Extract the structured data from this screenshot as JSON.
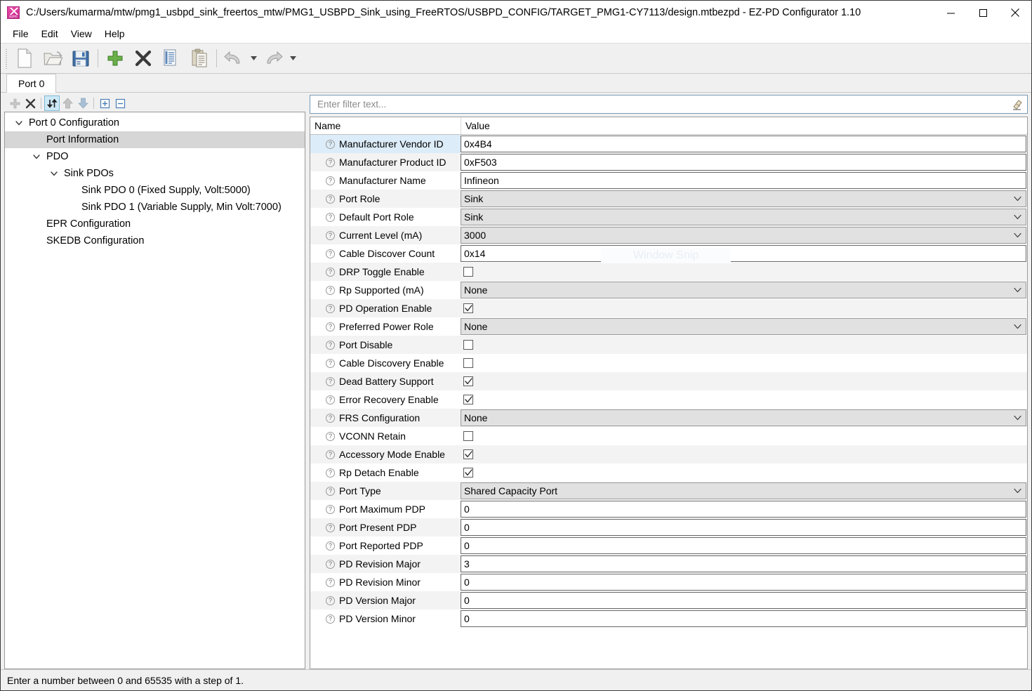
{
  "window": {
    "title": "C:/Users/kumarma/mtw/pmg1_usbpd_sink_freertos_mtw/PMG1_USBPD_Sink_using_FreeRTOS/USBPD_CONFIG/TARGET_PMG1-CY7113/design.mtbezpd - EZ-PD Configurator 1.10",
    "app_icon": "ezpd-logo-icon",
    "minimize": "—",
    "maximize": "□",
    "close": "✕"
  },
  "menubar": {
    "items": [
      {
        "label": "File"
      },
      {
        "label": "Edit"
      },
      {
        "label": "View"
      },
      {
        "label": "Help"
      }
    ]
  },
  "toolbar": {
    "buttons": [
      {
        "name": "new-file-icon",
        "tip": "New"
      },
      {
        "name": "open-folder-icon",
        "tip": "Open"
      },
      {
        "name": "save-icon",
        "tip": "Save"
      },
      {
        "name": "add-plus-icon",
        "tip": "Add"
      },
      {
        "name": "delete-x-icon",
        "tip": "Delete"
      },
      {
        "name": "copy-icon",
        "tip": "Copy"
      },
      {
        "name": "paste-icon",
        "tip": "Paste"
      },
      {
        "name": "undo-icon",
        "tip": "Undo"
      },
      {
        "name": "redo-icon",
        "tip": "Redo"
      }
    ]
  },
  "tabs": [
    {
      "label": "Port 0",
      "active": true
    }
  ],
  "tree_toolbar": {
    "buttons": [
      {
        "name": "add-icon",
        "active": false
      },
      {
        "name": "delete-icon",
        "active": false
      },
      {
        "name": "sort-toggle-icon",
        "active": true
      },
      {
        "name": "move-up-icon",
        "active": false
      },
      {
        "name": "move-down-icon",
        "active": false
      },
      {
        "name": "expand-all-icon",
        "active": false
      },
      {
        "name": "collapse-all-icon",
        "active": false
      }
    ]
  },
  "tree": {
    "items": [
      {
        "label": "Port 0 Configuration",
        "depth": 0,
        "twisty": "expanded",
        "selected": false
      },
      {
        "label": "Port Information",
        "depth": 1,
        "twisty": "none",
        "selected": true
      },
      {
        "label": "PDO",
        "depth": 1,
        "twisty": "expanded",
        "selected": false
      },
      {
        "label": "Sink PDOs",
        "depth": 2,
        "twisty": "expanded",
        "selected": false
      },
      {
        "label": "Sink PDO 0 (Fixed Supply, Volt:5000)",
        "depth": 3,
        "twisty": "none",
        "selected": false
      },
      {
        "label": "Sink PDO 1 (Variable Supply, Min Volt:7000)",
        "depth": 3,
        "twisty": "none",
        "selected": false
      },
      {
        "label": "EPR Configuration",
        "depth": 1,
        "twisty": "none",
        "selected": false
      },
      {
        "label": "SKEDB Configuration",
        "depth": 1,
        "twisty": "none",
        "selected": false
      }
    ]
  },
  "filter": {
    "value": "",
    "placeholder": "Enter filter text...",
    "clear_icon": "eraser-icon"
  },
  "table": {
    "columns": [
      "Name",
      "Value"
    ],
    "rows": [
      {
        "name": "Manufacturer Vendor ID",
        "type": "text",
        "value": "0x4B4",
        "selected": true
      },
      {
        "name": "Manufacturer Product ID",
        "type": "text",
        "value": "0xF503",
        "selected": false
      },
      {
        "name": "Manufacturer Name",
        "type": "text",
        "value": "Infineon",
        "selected": false
      },
      {
        "name": "Port Role",
        "type": "combo",
        "value": "Sink",
        "selected": false
      },
      {
        "name": "Default Port Role",
        "type": "combo",
        "value": "Sink",
        "selected": false
      },
      {
        "name": "Current Level (mA)",
        "type": "combo",
        "value": "3000",
        "selected": false
      },
      {
        "name": "Cable Discover Count",
        "type": "text",
        "value": "0x14",
        "selected": false
      },
      {
        "name": "DRP Toggle Enable",
        "type": "checkbox",
        "value": false,
        "selected": false
      },
      {
        "name": "Rp Supported (mA)",
        "type": "combo",
        "value": "None",
        "selected": false
      },
      {
        "name": "PD Operation Enable",
        "type": "checkbox",
        "value": true,
        "selected": false
      },
      {
        "name": "Preferred Power Role",
        "type": "combo",
        "value": "None",
        "selected": false
      },
      {
        "name": "Port Disable",
        "type": "checkbox",
        "value": false,
        "selected": false
      },
      {
        "name": "Cable Discovery Enable",
        "type": "checkbox",
        "value": false,
        "selected": false
      },
      {
        "name": "Dead Battery Support",
        "type": "checkbox",
        "value": true,
        "selected": false
      },
      {
        "name": "Error Recovery Enable",
        "type": "checkbox",
        "value": true,
        "selected": false
      },
      {
        "name": "FRS Configuration",
        "type": "combo",
        "value": "None",
        "selected": false
      },
      {
        "name": "VCONN Retain",
        "type": "checkbox",
        "value": false,
        "selected": false
      },
      {
        "name": "Accessory Mode Enable",
        "type": "checkbox",
        "value": true,
        "selected": false
      },
      {
        "name": "Rp Detach Enable",
        "type": "checkbox",
        "value": true,
        "selected": false
      },
      {
        "name": "Port Type",
        "type": "combo",
        "value": "Shared Capacity Port",
        "selected": false
      },
      {
        "name": "Port Maximum PDP",
        "type": "text",
        "value": "0",
        "selected": false
      },
      {
        "name": "Port Present PDP",
        "type": "text",
        "value": "0",
        "selected": false
      },
      {
        "name": "Port Reported PDP",
        "type": "text",
        "value": "0",
        "selected": false
      },
      {
        "name": "PD Revision Major",
        "type": "text",
        "value": "3",
        "selected": false
      },
      {
        "name": "PD Revision Minor",
        "type": "text",
        "value": "0",
        "selected": false
      },
      {
        "name": "PD Version Major",
        "type": "text",
        "value": "0",
        "selected": false
      },
      {
        "name": "PD Version Minor",
        "type": "text",
        "value": "0",
        "selected": false
      }
    ]
  },
  "watermark": {
    "text": "Window Snip"
  },
  "statusbar": {
    "text": "Enter a number between 0 and 65535 with a step of 1."
  },
  "colors": {
    "selection_blue": "#dcecf8",
    "tree_selection": "#d6d6d6",
    "combo_fill": "#e1e1e1",
    "row_alt": "#f3f3f3",
    "toolbar_active": "#cde8f6",
    "accent_green": "#5aa02c",
    "accent_blue": "#3a6ea5"
  }
}
